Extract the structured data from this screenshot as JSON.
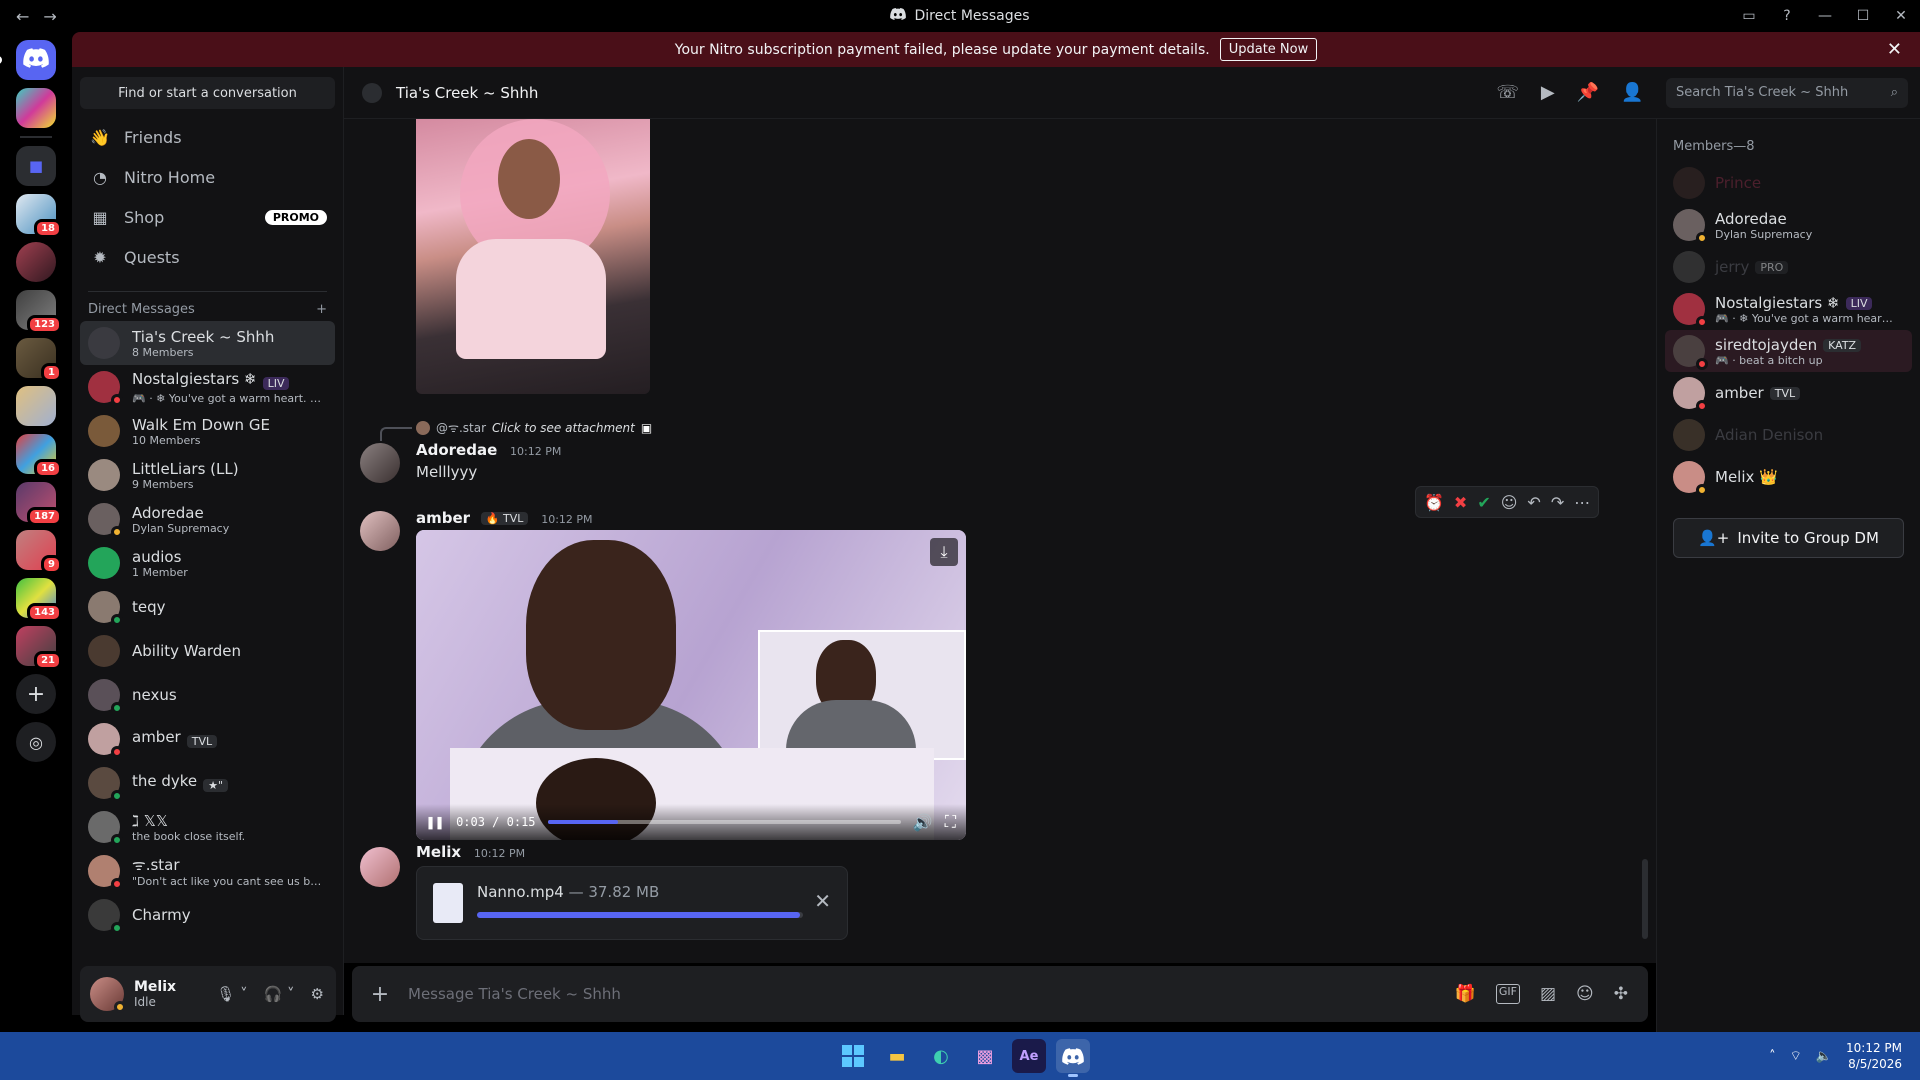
{
  "window": {
    "title": "Direct Messages"
  },
  "banner": {
    "message": "Your Nitro subscription payment failed, please update your payment details.",
    "button": "Update Now"
  },
  "rail": {
    "badges": [
      "18",
      "123",
      "1",
      "16",
      "187",
      "9",
      "143",
      "21"
    ]
  },
  "sidebar": {
    "find_placeholder": "Find or start a conversation",
    "nav": [
      {
        "label": "Friends"
      },
      {
        "label": "Nitro Home"
      },
      {
        "label": "Shop",
        "badge": "PROMO"
      },
      {
        "label": "Quests"
      }
    ],
    "dm_header": "Direct Messages",
    "dms": [
      {
        "name": "Tia's Creek ~ Shhh",
        "sub": "8 Members",
        "color": "#3a3a40"
      },
      {
        "name": "Nostalgiestars ❄",
        "tag": "LIV",
        "sub": "🎮 · ❄ You've got a warm heart. Yo...",
        "color": "#a03040"
      },
      {
        "name": "Walk Em Down GE",
        "sub": "10 Members",
        "color": "#7a5a3a"
      },
      {
        "name": "LittleLiars (LL)",
        "sub": "9 Members",
        "color": "#9a8a80"
      },
      {
        "name": "Adoredae",
        "sub": "Dylan Supremacy",
        "color": "#6a6060"
      },
      {
        "name": "audios",
        "sub": "1 Member",
        "color": "#23a55a"
      },
      {
        "name": "teqy",
        "sub": "",
        "color": "#8a7a70"
      },
      {
        "name": "Ability Warden",
        "sub": "",
        "color": "#4a3a30"
      },
      {
        "name": "nexus",
        "sub": "",
        "color": "#5a5058"
      },
      {
        "name": "amber",
        "tag": "TVL",
        "sub": "",
        "color": "#c0a0a0"
      },
      {
        "name": "the dyke",
        "tag": "★\"",
        "sub": "",
        "color": "#5a4a40"
      },
      {
        "name": "ℷ 𝕏𝕏",
        "sub": "the book close itself.",
        "color": "#6a6a6a"
      },
      {
        "name": "ᯤ.star",
        "sub": "\"Don't act like you cant see us bitch\"",
        "color": "#b08070"
      },
      {
        "name": "Charmy",
        "sub": "",
        "color": "#3a3a3a"
      }
    ]
  },
  "user": {
    "name": "Melix",
    "status": "Idle"
  },
  "chat": {
    "channel": "Tia's Creek ~ Shhh",
    "search_placeholder": "Search Tia's Creek ~ Shhh",
    "reply": {
      "author": "@ᯤ.star",
      "text": "Click to see attachment"
    },
    "messages": [
      {
        "author": "Adoredae",
        "time": "10:12 PM",
        "text": "Melllyyy"
      },
      {
        "author": "amber",
        "tag": "TVL",
        "time": "10:12 PM"
      },
      {
        "author": "Melix",
        "time": "10:12 PM"
      }
    ],
    "video": {
      "time": "0:03 / 0:15",
      "progress": 0.2
    },
    "upload": {
      "file": "Nanno.mp4",
      "size": "— 37.82 MB",
      "progress": 0.99
    },
    "composer_placeholder": "Message Tia's Creek ~ Shhh"
  },
  "members": {
    "header": "Members—8",
    "list": [
      {
        "name": "Prince",
        "sub": "",
        "offline": true,
        "color": "#3a2a28",
        "name_color": "#7a2a40"
      },
      {
        "name": "Adoredae",
        "sub": "Dylan Supremacy",
        "color": "#6a6060"
      },
      {
        "name": "jerry",
        "tag": "PRO",
        "sub": "",
        "offline": true,
        "color": "#4a4a4a"
      },
      {
        "name": "Nostalgiestars ❄",
        "tag": "LIV",
        "sub": "🎮 · ❄ You've got a warm heart. ...",
        "color": "#a03040"
      },
      {
        "name": "siredtojayden",
        "tag": "KATZ",
        "sub": "🎮 · beat a bitch up",
        "color": "#4a4040",
        "highlight": true
      },
      {
        "name": "amber",
        "tag": "TVL",
        "sub": "",
        "color": "#c0a0a0"
      },
      {
        "name": "Adian Denison",
        "sub": "",
        "offline": true,
        "color": "#5a4a3a"
      },
      {
        "name": "Melix 👑",
        "sub": "",
        "color": "#c98d86"
      }
    ],
    "invite": "Invite to Group DM"
  },
  "taskbar": {
    "time": "10:12 PM",
    "date": "8/5/2026"
  },
  "colors": {
    "accent": "#5865f2",
    "danger": "#f23f43",
    "idle": "#f0b232",
    "online": "#23a55a",
    "dnd": "#f23f43"
  }
}
